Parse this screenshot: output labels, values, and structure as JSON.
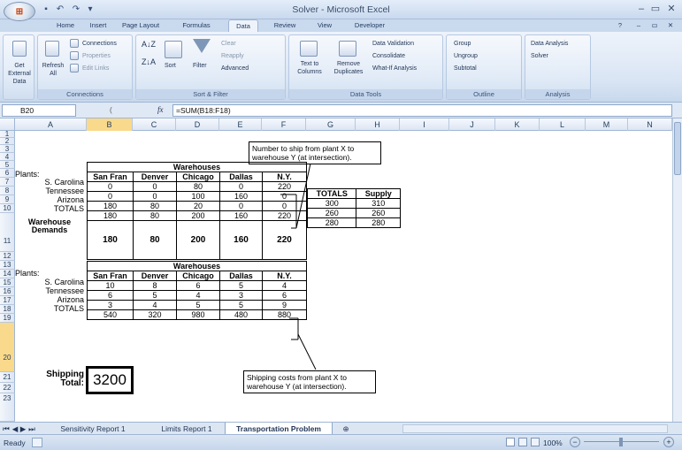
{
  "window": {
    "title": "Solver - Microsoft Excel"
  },
  "tabs": [
    "Home",
    "Insert",
    "Page Layout",
    "Formulas",
    "Data",
    "Review",
    "View",
    "Developer"
  ],
  "active_tab": "Data",
  "ribbon": {
    "get_external_data": "Get External Data",
    "refresh_all": "Refresh All",
    "connections": "Connections",
    "properties": "Properties",
    "edit_links": "Edit Links",
    "connections_group": "Connections",
    "sort": "Sort",
    "filter": "Filter",
    "clear": "Clear",
    "reapply": "Reapply",
    "advanced": "Advanced",
    "sort_filter_group": "Sort & Filter",
    "text_to_columns": "Text to Columns",
    "remove_duplicates": "Remove Duplicates",
    "data_validation": "Data Validation",
    "consolidate": "Consolidate",
    "what_if": "What-If Analysis",
    "data_tools_group": "Data Tools",
    "group": "Group",
    "ungroup": "Ungroup",
    "subtotal": "Subtotal",
    "outline_group": "Outline",
    "data_analysis": "Data Analysis",
    "solver": "Solver",
    "analysis_group": "Analysis"
  },
  "formula_bar": {
    "name_box": "B20",
    "fx": "fx",
    "formula": "=SUM(B18:F18)"
  },
  "columns": [
    "A",
    "B",
    "C",
    "D",
    "E",
    "F",
    "G",
    "H",
    "I",
    "J",
    "K",
    "L",
    "M",
    "N"
  ],
  "rows": [
    "1",
    "2",
    "3",
    "4",
    "5",
    "6",
    "7",
    "8",
    "9",
    "10",
    "11",
    "12",
    "13",
    "14",
    "15",
    "16",
    "17",
    "18",
    "19",
    "20",
    "21",
    "22",
    "23"
  ],
  "top_table": {
    "header": "Warehouses",
    "col_headers": [
      "San Fran",
      "Denver",
      "Chicago",
      "Dallas",
      "N.Y."
    ],
    "plants_label": "Plants:",
    "rows": [
      {
        "label": "S. Carolina",
        "values": [
          "0",
          "0",
          "80",
          "0",
          "220"
        ]
      },
      {
        "label": "Tennessee",
        "values": [
          "0",
          "0",
          "100",
          "160",
          "0"
        ]
      },
      {
        "label": "Arizona",
        "values": [
          "180",
          "80",
          "20",
          "0",
          "0"
        ]
      }
    ],
    "totals_label": "TOTALS",
    "totals": [
      "180",
      "80",
      "200",
      "160",
      "220"
    ],
    "demands_label_1": "Warehouse",
    "demands_label_2": "Demands",
    "demands": [
      "180",
      "80",
      "200",
      "160",
      "220"
    ],
    "side_headers": [
      "TOTALS",
      "Supply"
    ],
    "side_rows": [
      [
        "300",
        "310"
      ],
      [
        "260",
        "260"
      ],
      [
        "280",
        "280"
      ]
    ]
  },
  "bottom_table": {
    "header": "Warehouses",
    "col_headers": [
      "San Fran",
      "Denver",
      "Chicago",
      "Dallas",
      "N.Y."
    ],
    "plants_label": "Plants:",
    "rows": [
      {
        "label": "S. Carolina",
        "values": [
          "10",
          "8",
          "6",
          "5",
          "4"
        ]
      },
      {
        "label": "Tennessee",
        "values": [
          "6",
          "5",
          "4",
          "3",
          "6"
        ]
      },
      {
        "label": "Arizona",
        "values": [
          "3",
          "4",
          "5",
          "5",
          "9"
        ]
      }
    ],
    "totals_label": "TOTALS",
    "totals": [
      "540",
      "320",
      "980",
      "480",
      "880"
    ]
  },
  "shipping": {
    "label_1": "Shipping",
    "label_2": "Total:",
    "value": "3200"
  },
  "callouts": {
    "top_1": "Number to ship from plant X to",
    "top_2": "warehouse Y (at intersection).",
    "bottom_1": "Shipping costs from plant X to",
    "bottom_2": "warehouse Y (at intersection)."
  },
  "sheets": [
    "Sensitivity Report 1",
    "Limits Report 1",
    "Transportation Problem"
  ],
  "active_sheet": "Transportation Problem",
  "status": {
    "mode": "Ready",
    "zoom": "100%"
  }
}
